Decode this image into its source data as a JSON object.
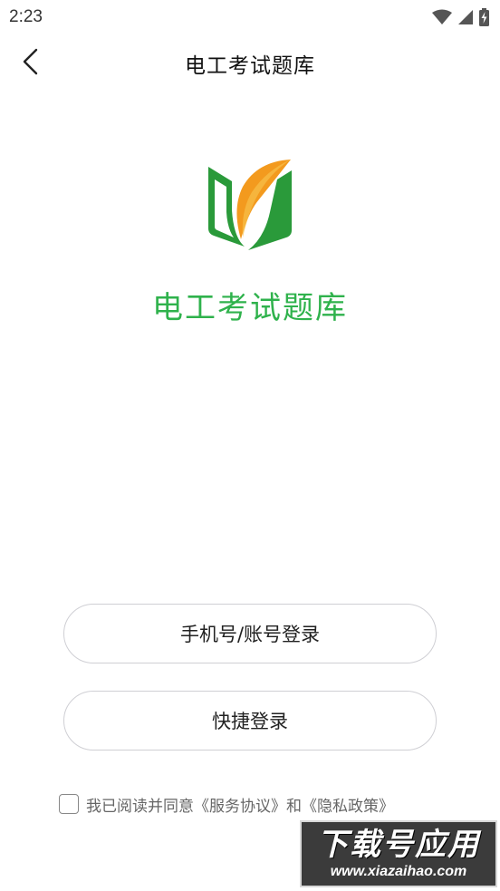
{
  "status_bar": {
    "time": "2:23",
    "icons": [
      "wifi-icon",
      "signal-icon",
      "battery-charging-icon"
    ]
  },
  "header": {
    "title": "电工考试题库",
    "back_icon": "chevron-left-icon"
  },
  "app": {
    "name": "电工考试题库",
    "logo_icon": "book-leaf-logo",
    "brand_color": "#2fb24c",
    "logo_colors": {
      "green": "#2a9a3a",
      "orange": "#f39a1e"
    }
  },
  "buttons": {
    "phone_login": "手机号/账号登录",
    "quick_login": "快捷登录"
  },
  "agreement": {
    "prefix": "我已阅读并同意",
    "service": "《服务协议》",
    "and": "和",
    "privacy": "《隐私政策》",
    "checked": false
  },
  "watermark": {
    "main": "下载号应用",
    "sub": "www.xiazaihao.com"
  }
}
